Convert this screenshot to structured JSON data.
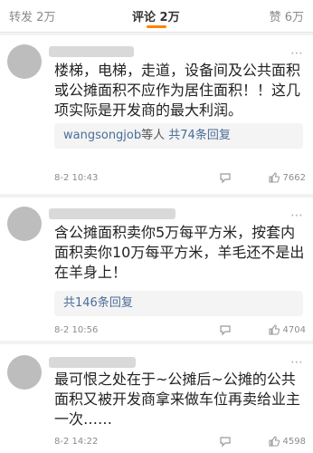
{
  "tabs": {
    "repost": "转发 2万",
    "comments": "评论 2万",
    "likes": "赞 6万"
  },
  "colors": {
    "accent": "#ff8200",
    "link": "#4a6d99"
  },
  "comments": [
    {
      "text": "楼梯，电梯，走道，设备间及公共面积或公摊面积不应作为居住面积！！这几项实际是开发商的最大利润。",
      "replies": {
        "user": "wangsongjob",
        "sep": "等人",
        "count": "共74条回复"
      },
      "time": "8-2 10:43",
      "likes": "7662"
    },
    {
      "text": "含公摊面积卖你5万每平方米，按套内面积卖你10万每平方米，羊毛还不是出在羊身上！",
      "replies": {
        "count": "共146条回复"
      },
      "time": "8-2 10:56",
      "likes": "4704"
    },
    {
      "text": "最可恨之处在于~公摊后~公摊的公共面积又被开发商拿来做车位再卖给业主一次……",
      "time": "8-2 14:22",
      "likes": "4598"
    }
  ],
  "icons": {
    "more": "more-icon",
    "reply": "comment-bubble-icon",
    "like": "thumbs-up-icon"
  }
}
